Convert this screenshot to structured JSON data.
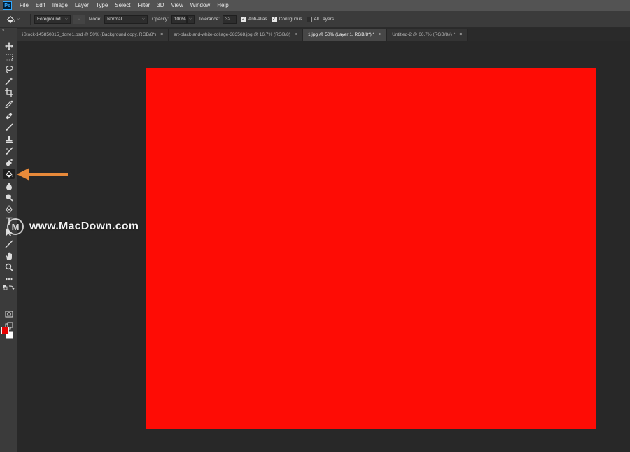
{
  "app": {
    "logo_text": "Ps",
    "menu": [
      "File",
      "Edit",
      "Image",
      "Layer",
      "Type",
      "Select",
      "Filter",
      "3D",
      "View",
      "Window",
      "Help"
    ]
  },
  "options_bar": {
    "fill_source": "Foreground",
    "mode_label": "Mode:",
    "mode_value": "Normal",
    "opacity_label": "Opacity:",
    "opacity_value": "100%",
    "tolerance_label": "Tolerance:",
    "tolerance_value": "32",
    "checkboxes": [
      {
        "label": "Anti-alias",
        "checked": true
      },
      {
        "label": "Contiguous",
        "checked": true
      },
      {
        "label": "All Layers",
        "checked": false
      }
    ]
  },
  "tabs": [
    {
      "label": "iStock-145850815_done1.psd @ 50% (Background copy, RGB/8*)",
      "close": "×",
      "active": false
    },
    {
      "label": "art-black-and-white-collage-383568.jpg @ 16.7% (RGB/8)",
      "close": "×",
      "active": false
    },
    {
      "label": "1.jpg @ 50% (Layer 1, RGB/8*) *",
      "close": "×",
      "active": true
    },
    {
      "label": "Untitled-2 @ 66.7% (RGB/8#) *",
      "close": "×",
      "active": false
    }
  ],
  "toolbar": {
    "collapse_glyph": "»",
    "tools": [
      "move-tool",
      "marquee-tool",
      "lasso-tool",
      "magic-wand-tool",
      "crop-tool",
      "eyedropper-tool",
      "healing-brush-tool",
      "brush-tool",
      "clone-stamp-tool",
      "history-brush-tool",
      "eraser-tool",
      "paint-bucket-tool",
      "blur-tool",
      "dodge-tool",
      "pen-tool",
      "type-tool",
      "path-selection-tool",
      "line-tool",
      "hand-tool",
      "zoom-tool",
      "more-tools",
      "default-colors",
      "foreground-background",
      "quick-mask",
      "screen-mode"
    ],
    "selected_tool": "paint-bucket-tool"
  },
  "colors": {
    "foreground": "#e60000",
    "background": "#ffffff",
    "canvas_fill": "#fe0c05",
    "arrow": "#e88a3a"
  },
  "watermark": {
    "logo_letter": "M",
    "text": "www.MacDown.com"
  }
}
